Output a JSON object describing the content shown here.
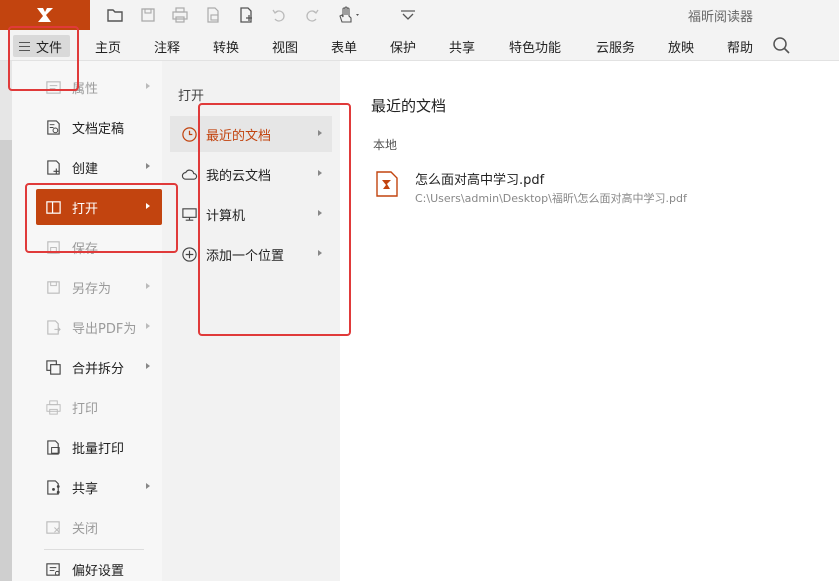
{
  "window": {
    "app_title": "福昕阅读器"
  },
  "menubar": {
    "file_label": "文件",
    "items": [
      "主页",
      "注释",
      "转换",
      "视图",
      "表单",
      "保护",
      "共享",
      "特色功能",
      "云服务",
      "放映",
      "帮助"
    ]
  },
  "file_menu": {
    "items": [
      {
        "label": "属性",
        "disabled": true,
        "has_submenu": true
      },
      {
        "label": "文档定稿",
        "disabled": false,
        "has_submenu": false
      },
      {
        "label": "创建",
        "disabled": false,
        "has_submenu": true
      },
      {
        "label": "打开",
        "disabled": false,
        "has_submenu": true,
        "active": true
      },
      {
        "label": "保存",
        "disabled": true,
        "has_submenu": false
      },
      {
        "label": "另存为",
        "disabled": true,
        "has_submenu": true
      },
      {
        "label": "导出PDF为",
        "disabled": true,
        "has_submenu": true
      },
      {
        "label": "合并拆分",
        "disabled": false,
        "has_submenu": true
      },
      {
        "label": "打印",
        "disabled": true,
        "has_submenu": false
      },
      {
        "label": "批量打印",
        "disabled": false,
        "has_submenu": false
      },
      {
        "label": "共享",
        "disabled": false,
        "has_submenu": true
      },
      {
        "label": "关闭",
        "disabled": true,
        "has_submenu": false
      },
      {
        "label": "偏好设置",
        "disabled": false,
        "has_submenu": false
      }
    ]
  },
  "open_submenu": {
    "heading": "打开",
    "items": [
      {
        "label": "最近的文档",
        "active": true
      },
      {
        "label": "我的云文档"
      },
      {
        "label": "计算机"
      },
      {
        "label": "添加一个位置"
      }
    ]
  },
  "recent_panel": {
    "title": "最近的文档",
    "section": "本地",
    "documents": [
      {
        "name": "怎么面对高中学习.pdf",
        "path": "C:\\Users\\admin\\Desktop\\福昕\\怎么面对高中学习.pdf"
      }
    ]
  },
  "colors": {
    "accent": "#c2440f",
    "highlight_box": "#e03a3a"
  }
}
